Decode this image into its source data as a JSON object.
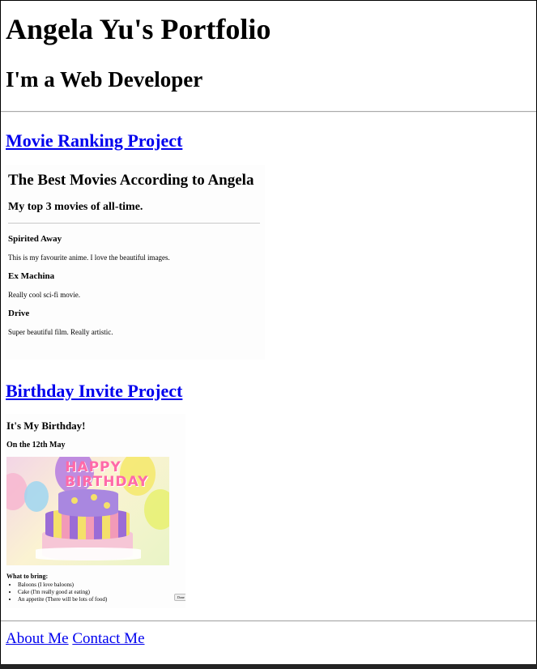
{
  "header": {
    "title": "Angela Yu's Portfolio",
    "subtitle": "I'm a Web Developer"
  },
  "projects": {
    "movie": {
      "link_label": "Movie Ranking Project",
      "preview": {
        "title": "The Best Movies According to Angela",
        "subtitle": "My top 3 movies of all-time.",
        "movies": [
          {
            "name": "Spirited Away",
            "desc": "This is my favourite anime. I love the beautiful images."
          },
          {
            "name": "Ex Machina",
            "desc": "Really cool sci-fi movie."
          },
          {
            "name": "Drive",
            "desc": "Super beautiful film. Really artistic."
          }
        ]
      }
    },
    "birthday": {
      "link_label": "Birthday Invite Project",
      "preview": {
        "title": "It's My Birthday!",
        "subtitle": "On the 12th May",
        "image_text": "HAPPY BIRTHDAY",
        "bring_label": "What to bring:",
        "items": [
          "Baloons (I love baloons)",
          "Cake (I'm really good at eating)",
          "An appetite (There will be lots of food)"
        ],
        "button_label": "Done"
      }
    }
  },
  "footer": {
    "about_label": "About Me",
    "contact_label": "Contact Me"
  },
  "colors": {
    "link": "#0000ee",
    "bottom_bar": "#232323"
  }
}
